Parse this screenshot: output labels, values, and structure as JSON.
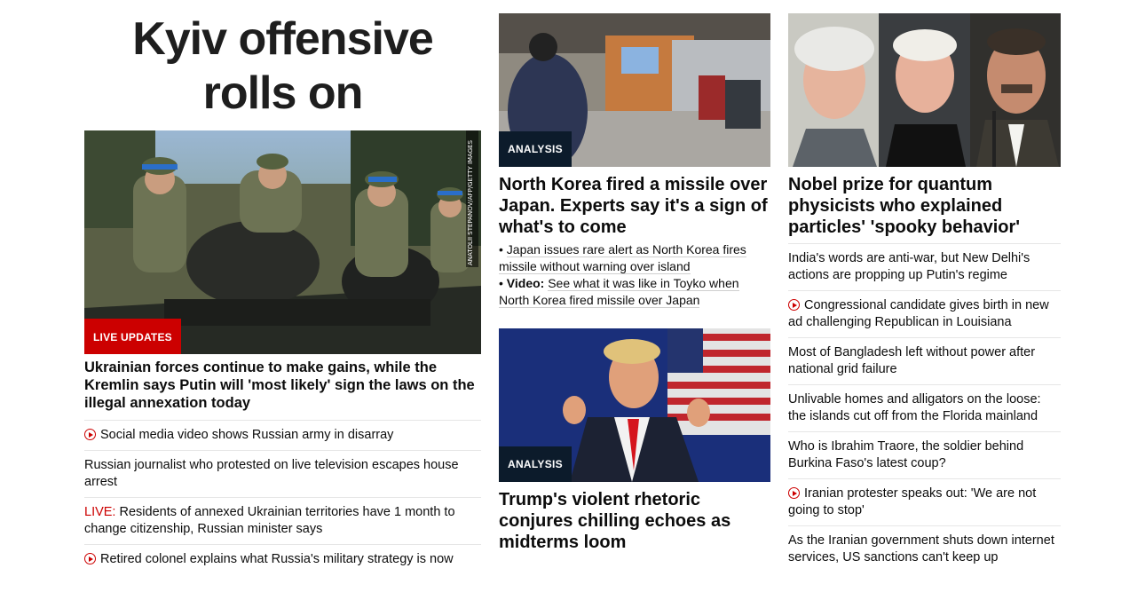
{
  "col1": {
    "headline_line1": "Kyiv offensive",
    "headline_line2": "rolls on",
    "image_badge": "LIVE UPDATES",
    "image_credit": "ANATOLII STEPANOV/AFP/GETTY IMAGES",
    "lead_story": "Ukrainian forces continue to make gains, while the Kremlin says Putin will 'most likely' sign the laws on the illegal annexation today",
    "links": [
      {
        "video": true,
        "live": "",
        "text": "Social media video shows Russian army in disarray"
      },
      {
        "video": false,
        "live": "",
        "text": "Russian journalist who protested on live television escapes house arrest"
      },
      {
        "video": false,
        "live": "LIVE:",
        "text": " Residents of annexed Ukrainian territories have 1 month to change citizenship, Russian minister says"
      },
      {
        "video": true,
        "live": "",
        "text": "Retired colonel explains what Russia's military strategy is now"
      }
    ]
  },
  "col2": {
    "story1": {
      "badge": "ANALYSIS",
      "title": "North Korea fired a missile over Japan. Experts say it's a sign of what's to come",
      "bullet1": "Japan issues rare alert as North Korea fires missile without warning over island",
      "bullet2_bold": "Video:",
      "bullet2": "See what it was like in Toyko when North Korea fired missile over Japan"
    },
    "story2": {
      "badge": "ANALYSIS",
      "title": "Trump's violent rhetoric conjures chilling echoes as midterms loom"
    }
  },
  "col3": {
    "title": "Nobel prize for quantum physicists who explained particles' 'spooky behavior'",
    "links": [
      {
        "video": false,
        "text": "India's words are anti-war, but New Delhi's actions are propping up Putin's regime"
      },
      {
        "video": true,
        "text": "Congressional candidate gives birth in new ad challenging Republican in Louisiana"
      },
      {
        "video": false,
        "text": "Most of Bangladesh left without power after national grid failure"
      },
      {
        "video": false,
        "text": "Unlivable homes and alligators on the loose: the islands cut off from the Florida mainland"
      },
      {
        "video": false,
        "text": "Who is Ibrahim Traore, the soldier behind Burkina Faso's latest coup?"
      },
      {
        "video": true,
        "text": "Iranian protester speaks out: 'We are not going to stop'"
      },
      {
        "video": false,
        "text": "As the Iranian government shuts down internet services, US sanctions can't keep up"
      }
    ]
  },
  "colors": {
    "accent_red": "#cc0000",
    "analysis_bg": "#0c1b2b",
    "text": "#0c0c0c"
  }
}
